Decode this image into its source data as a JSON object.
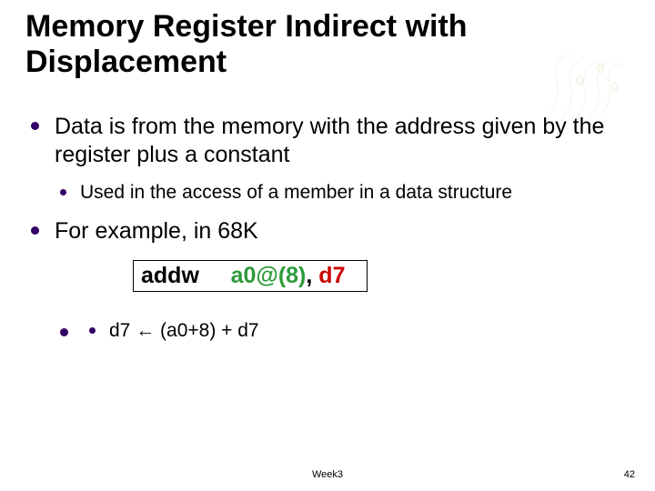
{
  "title": "Memory Register Indirect with Displacement",
  "bullets": [
    {
      "text": "Data is from the memory with the address given by the register plus a constant",
      "sub": [
        {
          "text": "Used in the access of a member in a data structure"
        }
      ]
    },
    {
      "text": "For example, in 68K",
      "sub": []
    }
  ],
  "code": {
    "mnemonic": "addw",
    "spacer": "     ",
    "operand1": "a0@(8)",
    "comma": ", ",
    "operand2": "d7"
  },
  "post_sub": [
    {
      "text": "d7 ← (a0+8) + d7"
    }
  ],
  "footer": {
    "center": "Week3",
    "right": "42"
  }
}
